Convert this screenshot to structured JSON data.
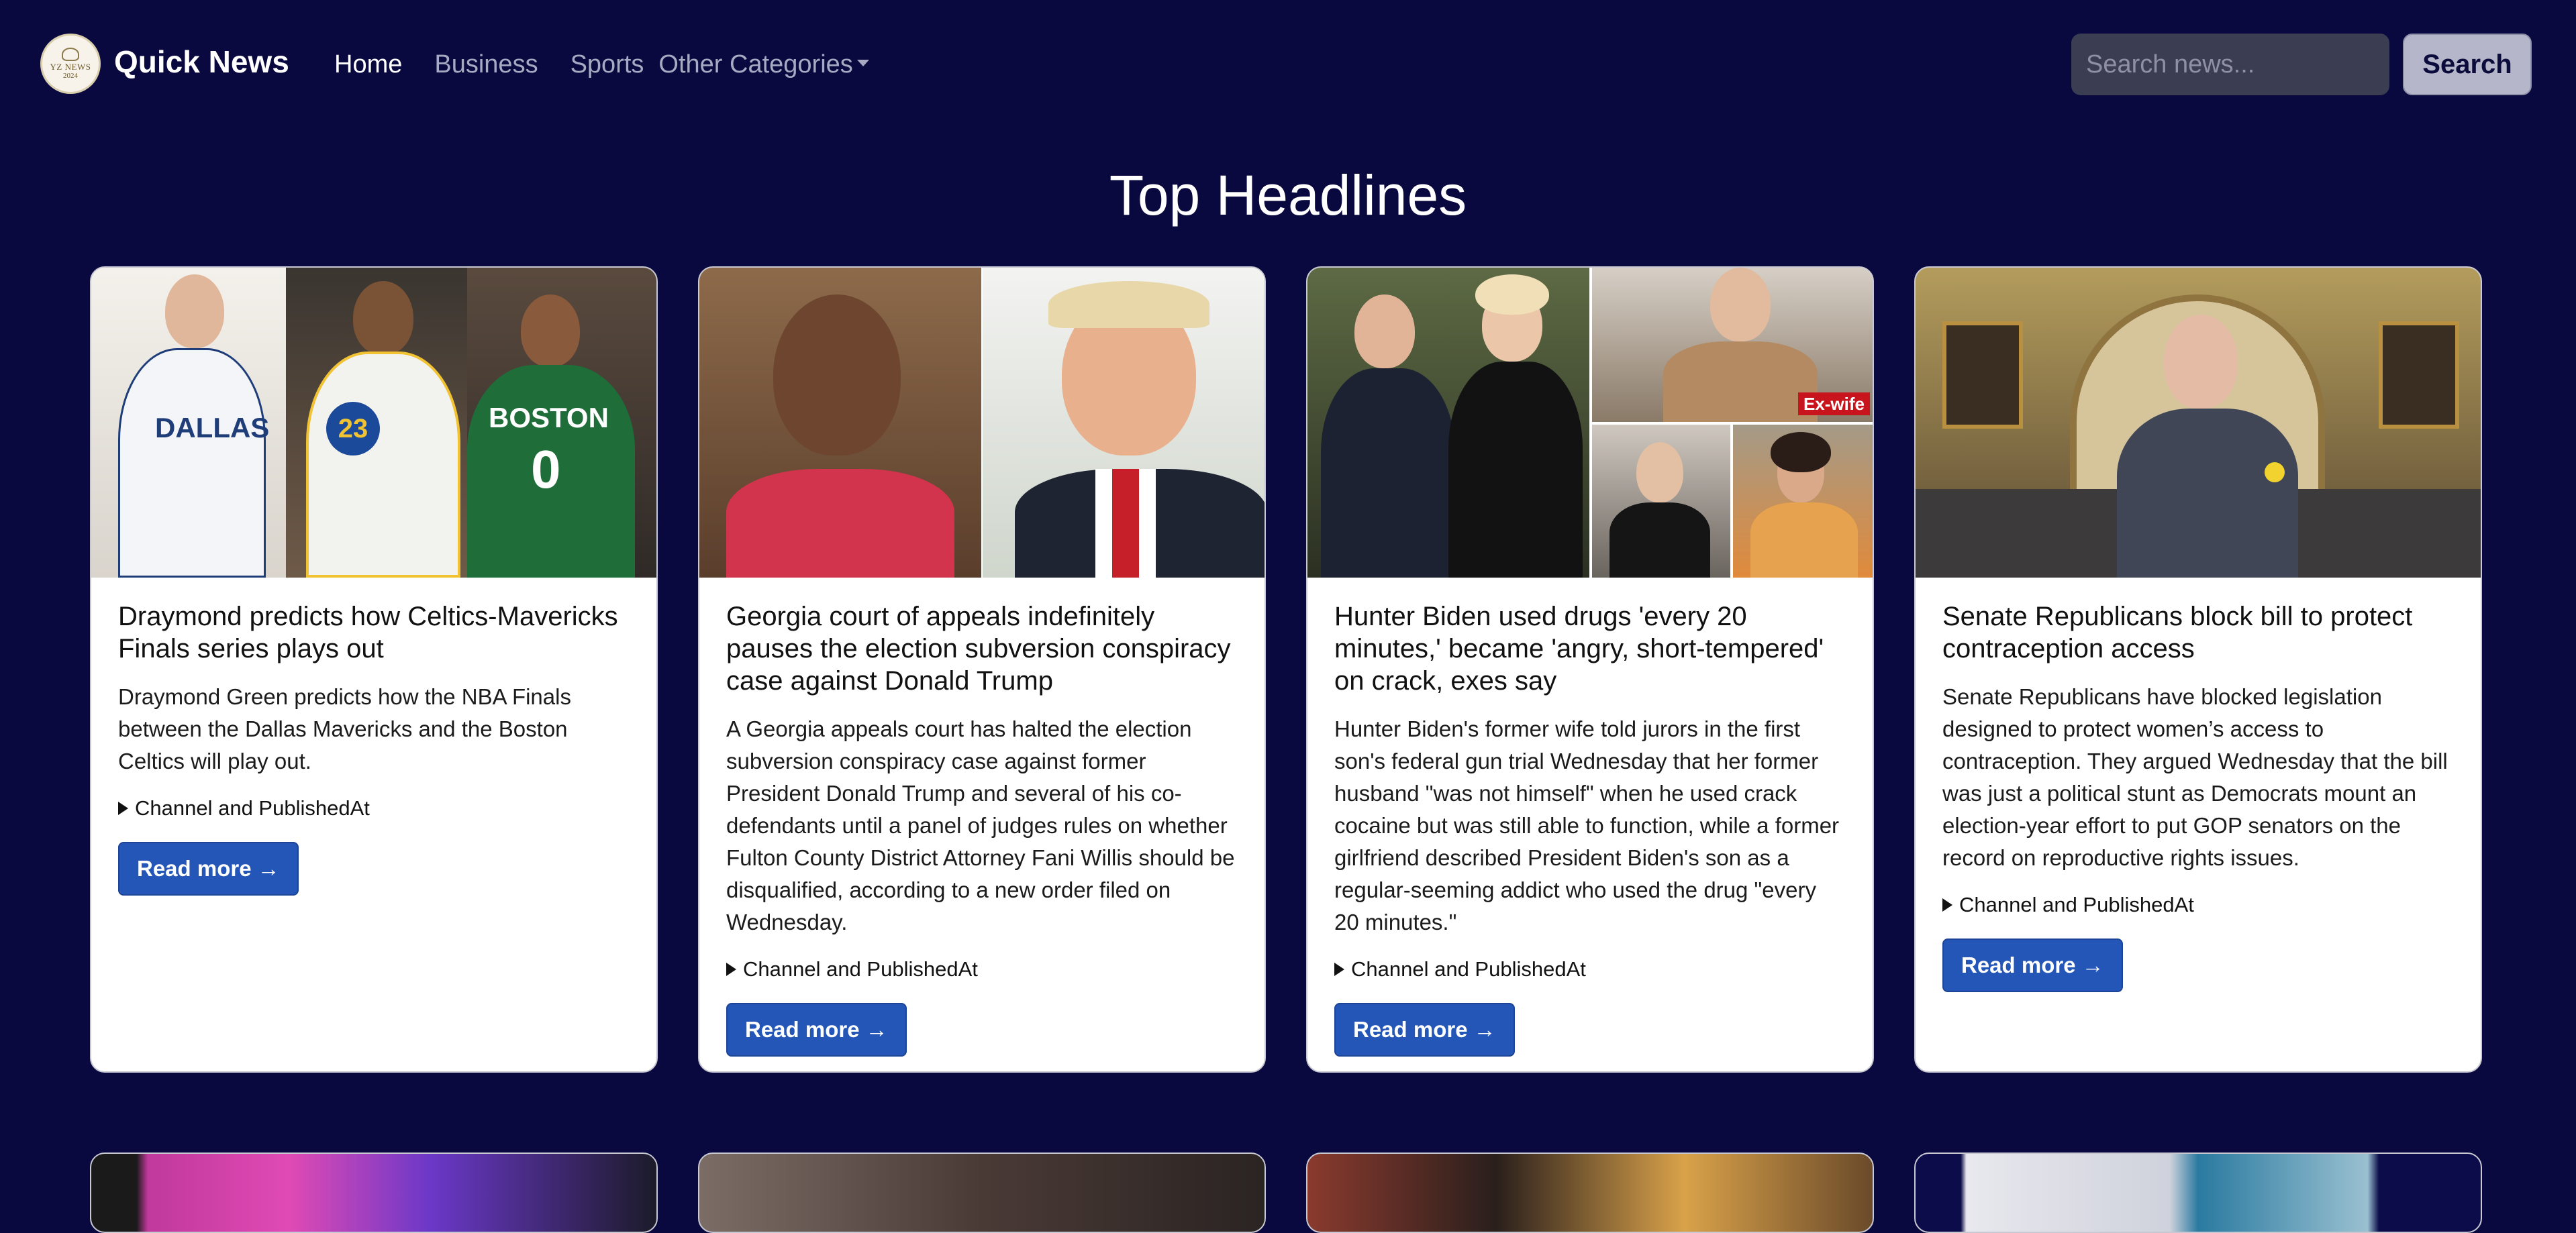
{
  "brand": {
    "name": "Quick News",
    "logo_text_top": "YZ NEWS",
    "logo_text_bottom": "2024"
  },
  "nav": {
    "home": "Home",
    "business": "Business",
    "sports": "Sports",
    "other": "Other Categories"
  },
  "search": {
    "placeholder": "Search news...",
    "button": "Search"
  },
  "page_title": "Top Headlines",
  "cards": [
    {
      "title": "Draymond predicts how Celtics-Mavericks Finals series plays out",
      "description": "Draymond Green predicts how the NBA Finals between the Dallas Mavericks and the Boston Celtics will play out.",
      "details_label": "Channel and PublishedAt",
      "read_more": "Read more →",
      "image_text": [
        "DALLAS",
        "23",
        "BOSTON",
        "0"
      ]
    },
    {
      "title": "Georgia court of appeals indefinitely pauses the election subversion conspiracy case against Donald Trump",
      "description": "A Georgia appeals court has halted the election subversion conspiracy case against former President Donald Trump and several of his co-defendants until a panel of judges rules on whether Fulton County District Attorney Fani Willis should be disqualified, according to a new order filed on Wednesday.",
      "details_label": "Channel and PublishedAt",
      "read_more": "Read more →"
    },
    {
      "title": "Hunter Biden used drugs 'every 20 minutes,' became 'angry, short-tempered' on crack, exes say",
      "description": "Hunter Biden's former wife told jurors in the first son's federal gun trial Wednesday that her former husband \"was not himself\" when he used crack cocaine but was still able to function, while a former girlfriend described President Biden's son as a regular-seeming addict who used the drug \"every 20 minutes.\"",
      "details_label": "Channel and PublishedAt",
      "read_more": "Read more →",
      "image_tag": "Ex-wife"
    },
    {
      "title": "Senate Republicans block bill to protect contraception access",
      "description": "Senate Republicans have blocked legislation designed to protect women’s access to contraception. They argued Wednesday that the bill was just a political stunt as Democrats mount an election-year effort to put GOP senators on the record on reproductive rights issues.",
      "details_label": "Channel and PublishedAt",
      "read_more": "Read more →"
    }
  ],
  "colors": {
    "background": "#09093f",
    "button": "#2456b8",
    "search_field": "#3b3d52",
    "search_button": "#b5b6c9",
    "exwife_tag": "#c8141c"
  },
  "icons": {
    "details_marker": "triangle-right-icon",
    "dropdown": "caret-down-icon"
  }
}
